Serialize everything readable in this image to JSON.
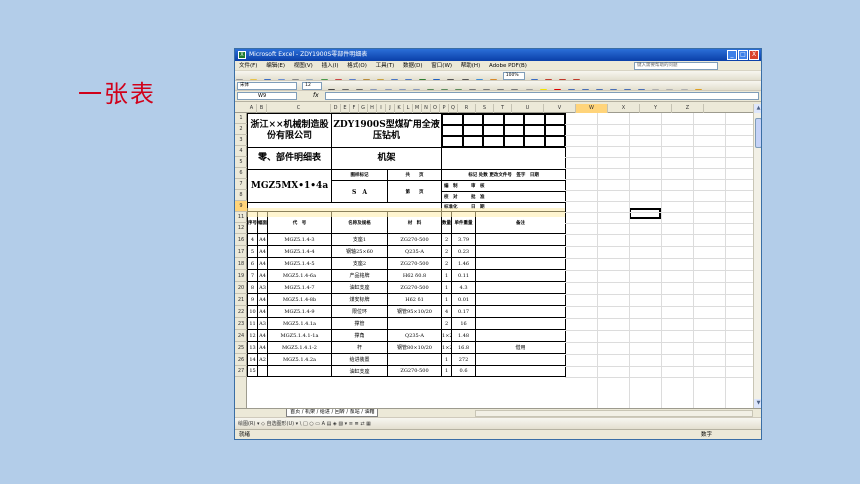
{
  "slide": {
    "title": "一张表"
  },
  "window": {
    "title": "Microsoft Excel - ZDY1900S零部件明细表",
    "app_icon": "excel-icon",
    "controls": [
      "_",
      "□",
      "X"
    ]
  },
  "menu": {
    "items": [
      "文件(F)",
      "编辑(E)",
      "视图(V)",
      "插入(I)",
      "格式(O)",
      "工具(T)",
      "数据(D)",
      "窗口(W)",
      "帮助(H)",
      "Adobe PDF(B)"
    ],
    "help_placeholder": "键入需要帮助的问题",
    "zoom": "100%",
    "font_name": "宋体",
    "font_size": "12"
  },
  "formula_bar": {
    "cell_ref": "W9",
    "fx": "fx",
    "value": ""
  },
  "columns": [
    "A",
    "B",
    "C",
    "D",
    "E",
    "F",
    "G",
    "H",
    "I",
    "J",
    "K",
    "L",
    "M",
    "N",
    "O",
    "P",
    "Q",
    "R",
    "S",
    "T",
    "U",
    "V",
    "W",
    "X",
    "Y",
    "Z"
  ],
  "rows": [
    "1",
    "2",
    "3",
    "4",
    "5",
    "6",
    "7",
    "8",
    "9",
    "11",
    "12",
    "16",
    "17",
    "18",
    "19",
    "20",
    "21",
    "22",
    "23",
    "24",
    "25",
    "26",
    "27"
  ],
  "sheet": {
    "company": "浙江××机械制造股份有限公司",
    "model": "ZDY1900S型煤矿用全液压钻机",
    "doc_title": "零、部件明细表",
    "part_name": "机架",
    "code": "MGZ5MX•1•4a",
    "mark_label": "图样标记",
    "total_label": "共",
    "sheet_label": "第",
    "page_label": "页",
    "s_mark": "S",
    "a_mark": "A",
    "rev": {
      "mark": "标记",
      "count": "处数",
      "doc_no": "更改文件号",
      "sign": "签字",
      "date": "日期"
    },
    "sign_rows": [
      {
        "l": "编　制",
        "r": "审　核"
      },
      {
        "l": "校　对",
        "r": "批　准"
      },
      {
        "l": "标准化",
        "r": "日　期"
      }
    ],
    "headers": {
      "seq": "序号",
      "size": "幅面",
      "code": "代　号",
      "name": "名称及规格",
      "material": "材　料",
      "qty": "数量",
      "unit_weight": "单件重量",
      "remark": "备注"
    },
    "parts": [
      {
        "seq": "4",
        "size": "A4",
        "code": "MGZ5.1.4-3",
        "name": "支座1",
        "material": "ZG270-500",
        "qty": "2",
        "weight": "3.79",
        "remark": ""
      },
      {
        "seq": "5",
        "size": "A4",
        "code": "MGZ5.1.4-4",
        "name": "钢轴25×60",
        "material": "Q235-A",
        "qty": "2",
        "weight": "0.23",
        "remark": ""
      },
      {
        "seq": "6",
        "size": "A4",
        "code": "MGZ5.1.4-5",
        "name": "支座2",
        "material": "ZG270-500",
        "qty": "2",
        "weight": "1.46",
        "remark": ""
      },
      {
        "seq": "7",
        "size": "A4",
        "code": "MGZ5.1.4-6a",
        "name": "产品铭牌",
        "material": "H62 δ0.8",
        "qty": "1",
        "weight": "0.11",
        "remark": ""
      },
      {
        "seq": "8",
        "size": "A3",
        "code": "MGZ5.1.4-7",
        "name": "油缸支座",
        "material": "ZG270-500",
        "qty": "1",
        "weight": "4.3",
        "remark": ""
      },
      {
        "seq": "9",
        "size": "A4",
        "code": "MGZ5.1.4-8b",
        "name": "煤安标牌",
        "material": "H62 δ1",
        "qty": "1",
        "weight": "0.01",
        "remark": ""
      },
      {
        "seq": "10",
        "size": "A4",
        "code": "MGZ5.1.4-9",
        "name": "限位环",
        "material": "钢管95×10/20",
        "qty": "4",
        "weight": "0.17",
        "remark": ""
      },
      {
        "seq": "11",
        "size": "A3",
        "code": "MGZ5.1.4.1a",
        "name": "撑管",
        "material": "",
        "qty": "2",
        "weight": "16",
        "remark": ""
      },
      {
        "seq": "12",
        "size": "A4",
        "code": "MGZ5.1.4.1-1a",
        "name": "撑角",
        "material": "Q235-A",
        "qty": "1×2",
        "weight": "1.48",
        "remark": ""
      },
      {
        "seq": "13",
        "size": "A4",
        "code": "MGZ5.1.4.1-2",
        "name": "杆",
        "material": "钢管80×10/20",
        "qty": "1×2",
        "weight": "16.8",
        "remark": "借用"
      },
      {
        "seq": "14",
        "size": "A2",
        "code": "MGZ5.1.4.2a",
        "name": "给进装置",
        "material": "",
        "qty": "1",
        "weight": "272",
        "remark": ""
      }
    ],
    "partial_row": {
      "seq": "15",
      "name": "油缸支座",
      "material": "ZG270-500",
      "qty": "1",
      "weight": "0.6"
    }
  },
  "sheet_tab": "首页 / 机架 / 给进 / 回转 / 泵站 / 油箱",
  "drawing_toolbar": "绘图(R) ▾  ◇  自选图形(U) ▾  \\  □  ○  ▭  A  ▤  ◈  ▨  ▾  ≡  ≣  ⇄  ▦",
  "status": {
    "left": "就绪",
    "right": "数字"
  }
}
